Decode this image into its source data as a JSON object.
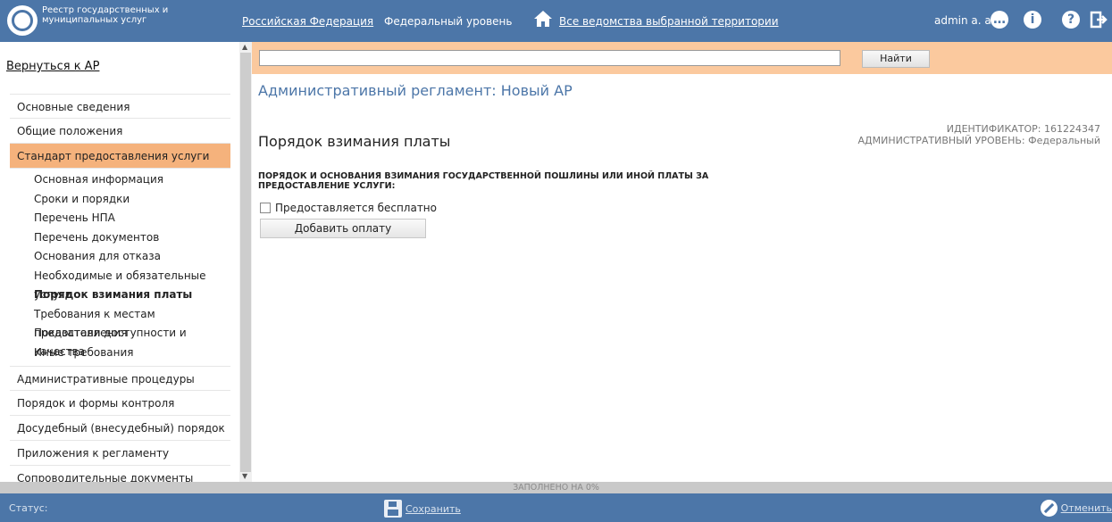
{
  "header": {
    "app_title": "Реестр государственных и муниципальных услуг",
    "nav_region": "Российская Федерация",
    "nav_level": "Федеральный уровень",
    "nav_departments": "Все ведомства выбранной территории",
    "user": "admin a. a."
  },
  "sidebar": {
    "back_link": "Вернуться к АР",
    "items": [
      {
        "label": "Основные сведения"
      },
      {
        "label": "Общие положения"
      },
      {
        "label": "Стандарт предоставления услуги",
        "active": true
      }
    ],
    "subitems": [
      {
        "label": "Основная информация"
      },
      {
        "label": "Сроки и порядки"
      },
      {
        "label": "Перечень НПА"
      },
      {
        "label": "Перечень документов"
      },
      {
        "label": "Основания для отказа"
      },
      {
        "label": "Необходимые и обязательные услуги"
      },
      {
        "label": "Порядок взимания платы",
        "current": true
      },
      {
        "label": "Требования к местам предоставления"
      },
      {
        "label": "Показатели доступности и качества"
      },
      {
        "label": "Иные требования"
      }
    ],
    "items_after": [
      {
        "label": "Административные процедуры"
      },
      {
        "label": "Порядок и формы контроля"
      },
      {
        "label": "Досудебный (внесудебный) порядок"
      },
      {
        "label": "Приложения к регламенту"
      },
      {
        "label": "Сопроводительные документы"
      }
    ]
  },
  "search": {
    "value": "",
    "button": "Найти"
  },
  "main": {
    "doc_title": "Административный регламент: Новый АР",
    "section_title": "Порядок взимания платы",
    "identifier": "ИДЕНТИФИКАТОР: 161224347",
    "admin_level": "АДМИНИСТРАТИВНЫЙ УРОВЕНЬ: Федеральный",
    "field_label": "ПОРЯДОК И ОСНОВАНИЯ ВЗИМАНИЯ ГОСУДАРСТВЕННОЙ ПОШЛИНЫ ИЛИ ИНОЙ ПЛАТЫ ЗА ПРЕДОСТАВЛЕНИЕ УСЛУГИ:",
    "free_checkbox": "Предоставляется бесплатно",
    "free_checked": false,
    "add_payment": "Добавить оплату"
  },
  "progress": {
    "label": "ЗАПОЛНЕНО НА 0%",
    "percent": 0
  },
  "statusbar": {
    "status_label": "Статус:",
    "save": "Сохранить",
    "cancel": "Отменить"
  },
  "colors": {
    "primary": "#4c76a8",
    "accent": "#f5b27c",
    "search_bg": "#fbc99e"
  }
}
